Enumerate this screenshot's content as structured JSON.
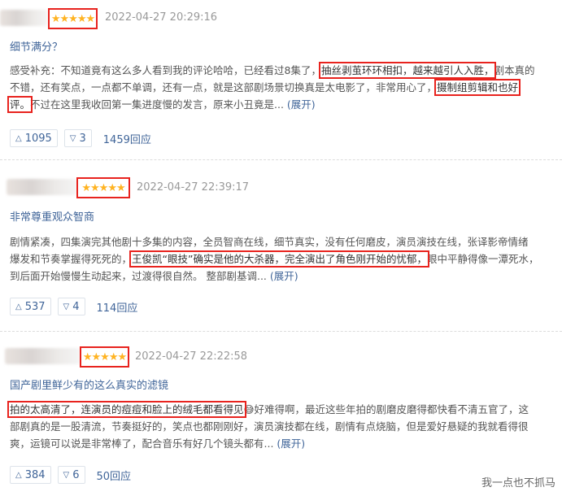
{
  "reviews": [
    {
      "rating_stars": "★★★★★",
      "rating": 5,
      "date": "2022-04-27 20:29:16",
      "title": "细节满分？",
      "body_line1_pre": "感受补充：不知道竟有这么多人看到我的评论哈哈，已经看过8集了，",
      "body_line1_hl": "抽丝剥茧环环相扣，越来越引人入胜，",
      "body_line1_post": "剧本真的",
      "body_line2_pre": "不错，还有笑点，一点都不单调，还有一点，就是这部剧场景切换真是太电影了，非常用心了，",
      "body_line2_hl": "摄制组剪辑和也好",
      "body_line3_hl": "评。",
      "body_line3_post": "不过在这里我收回第一集进度慢的发言，原来小丑竟是...",
      "more": "(展开)",
      "likes": "1095",
      "dislikes": "3",
      "replies": "1459回应"
    },
    {
      "rating_stars": "★★★★★",
      "rating": 5,
      "date": "2022-04-27 22:39:17",
      "title": "非常尊重观众智商",
      "body_line1": "剧情紧凑，四集演完其他剧十多集的内容，全员智商在线，细节真实，没有任何磨皮，演员演技在线，张译影帝情绪",
      "body_line2_pre": "爆发和节奏掌握得死死的，",
      "body_line2_hl": "王俊凯“眼技”确实是他的大杀器，完全演出了角色刚开始的忧郁，",
      "body_line2_post": "眼中平静得像一潭死水，",
      "body_line3": "到后面开始慢慢生动起来，过渡得很自然。  整部剧基调...",
      "more": "(展开)",
      "likes": "537",
      "dislikes": "4",
      "replies": "114回应"
    },
    {
      "rating_stars": "★★★★★",
      "rating": 5,
      "date": "2022-04-27 22:22:58",
      "title": "国产剧里鲜少有的这么真实的滤镜",
      "body_line1_hl": "拍的太高清了，连演员的痘痘和脸上的绒毛都看得见",
      "emoji": "😅",
      "body_line1_post": "好难得啊，最近这些年拍的剧磨皮磨得都快看不清五官了，这",
      "body_line2": "部剧真的是一股清流，节奏挺好的，笑点也都刚刚好，演员演技都在线，剧情有点烧脑，但是爱好悬疑的我就看得很",
      "body_line3": "爽，运镜可以说是非常棒了，配合音乐有好几个镜头都有...",
      "more": "(展开)",
      "likes": "384",
      "dislikes": "6",
      "replies": "50回应"
    }
  ],
  "icons": {
    "like": "triangle-up",
    "dislike": "triangle-down"
  },
  "watermark": "我一点也不抓马",
  "colors": {
    "link": "#406599",
    "star": "#ffb321",
    "highlight_border": "#e8231e",
    "meta": "#999999"
  }
}
